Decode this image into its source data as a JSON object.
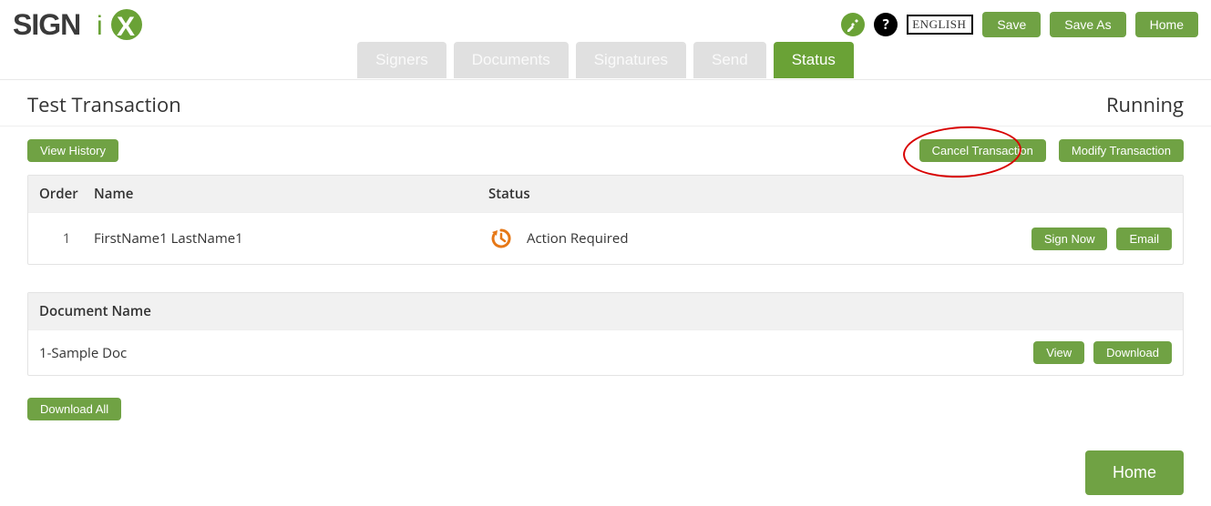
{
  "header": {
    "logo_text": "SIGNiX",
    "language": "ENGLISH",
    "buttons": {
      "save": "Save",
      "save_as": "Save As",
      "home": "Home"
    }
  },
  "tabs": [
    {
      "label": "Signers",
      "active": false
    },
    {
      "label": "Documents",
      "active": false
    },
    {
      "label": "Signatures",
      "active": false
    },
    {
      "label": "Send",
      "active": false
    },
    {
      "label": "Status",
      "active": true
    }
  ],
  "transaction": {
    "title": "Test Transaction",
    "state": "Running"
  },
  "actions": {
    "view_history": "View History",
    "cancel": "Cancel Transaction",
    "modify": "Modify Transaction"
  },
  "signers_table": {
    "headers": {
      "order": "Order",
      "name": "Name",
      "status": "Status"
    },
    "rows": [
      {
        "order": "1",
        "name": "FirstName1 LastName1",
        "status": "Action Required",
        "buttons": {
          "sign": "Sign Now",
          "email": "Email"
        }
      }
    ]
  },
  "documents_table": {
    "header": "Document Name",
    "rows": [
      {
        "name": "1-Sample Doc",
        "buttons": {
          "view": "View",
          "download": "Download"
        }
      }
    ]
  },
  "download_all": "Download All",
  "footer_home": "Home"
}
